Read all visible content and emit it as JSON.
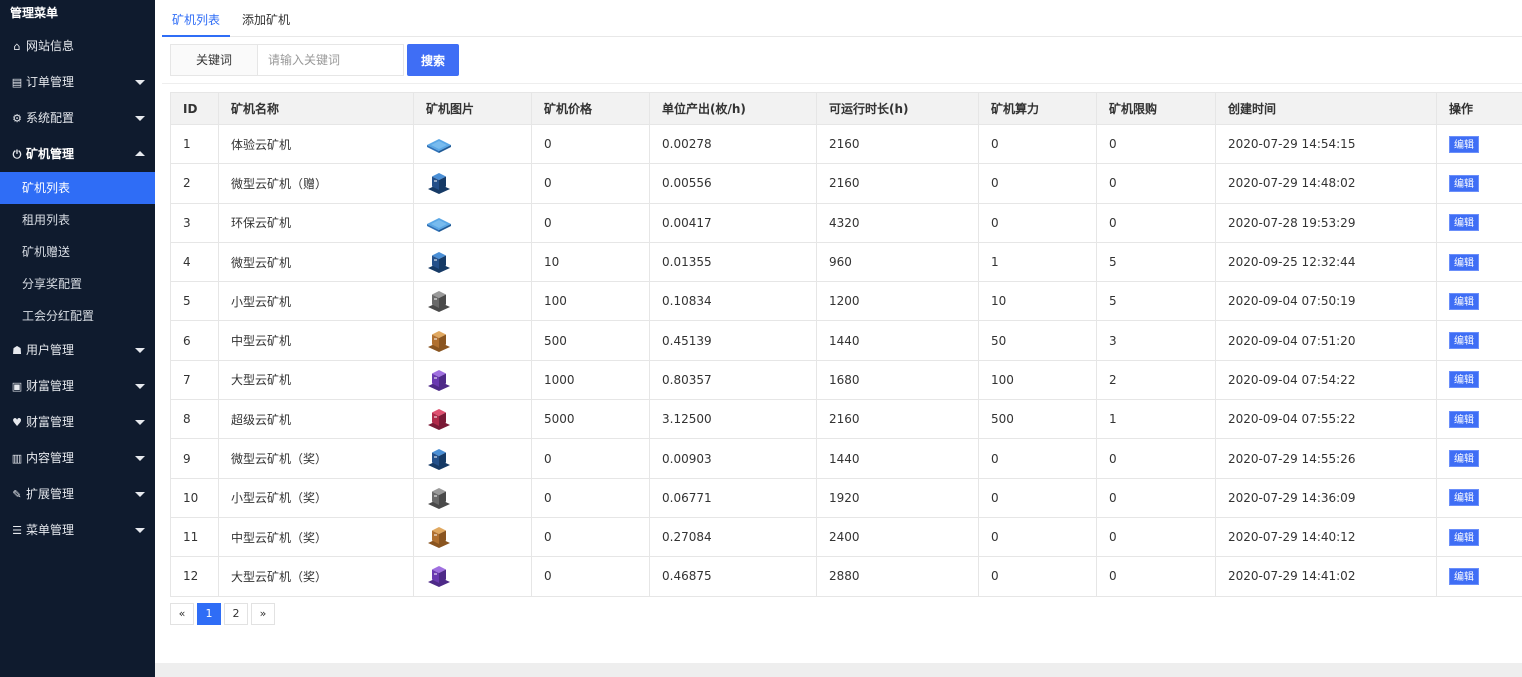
{
  "sidebar": {
    "header": "管理菜单",
    "items": [
      {
        "icon": "home-icon",
        "glyph": "⌂",
        "label": "网站信息"
      },
      {
        "icon": "list-icon",
        "glyph": "▤",
        "label": "订单管理"
      },
      {
        "icon": "gears-icon",
        "glyph": "⚙",
        "label": "系统配置"
      },
      {
        "icon": "power-icon",
        "glyph": "⏻",
        "label": "矿机管理"
      },
      {
        "icon": "users-icon",
        "glyph": "☗",
        "label": "用户管理"
      },
      {
        "icon": "money-icon",
        "glyph": "▣",
        "label": "财富管理"
      },
      {
        "icon": "heart-icon",
        "glyph": "♥",
        "label": "财富管理"
      },
      {
        "icon": "file-icon",
        "glyph": "▥",
        "label": "内容管理"
      },
      {
        "icon": "wrench-icon",
        "glyph": "✎",
        "label": "扩展管理"
      },
      {
        "icon": "bars-icon",
        "glyph": "☰",
        "label": "菜单管理"
      }
    ],
    "sub_items": [
      "矿机列表",
      "租用列表",
      "矿机赠送",
      "分享奖配置",
      "工会分红配置"
    ]
  },
  "tabs": [
    "矿机列表",
    "添加矿机"
  ],
  "search": {
    "label": "关键词",
    "placeholder": "请输入关键词",
    "button": "搜索"
  },
  "table": {
    "headers": [
      "ID",
      "矿机名称",
      "矿机图片",
      "矿机价格",
      "单位产出(枚/h)",
      "可运行时长(h)",
      "矿机算力",
      "矿机限购",
      "创建时间",
      "操作"
    ],
    "edit_label": "编辑",
    "rows": [
      {
        "id": "1",
        "name": "体验云矿机",
        "pic": "blue-flat",
        "price": "0",
        "output": "0.00278",
        "hours": "2160",
        "power": "0",
        "limit": "0",
        "created": "2020-07-29 14:54:15"
      },
      {
        "id": "2",
        "name": "微型云矿机（赠）",
        "pic": "blue-tower",
        "price": "0",
        "output": "0.00556",
        "hours": "2160",
        "power": "0",
        "limit": "0",
        "created": "2020-07-29 14:48:02"
      },
      {
        "id": "3",
        "name": "环保云矿机",
        "pic": "blue-flat",
        "price": "0",
        "output": "0.00417",
        "hours": "4320",
        "power": "0",
        "limit": "0",
        "created": "2020-07-28 19:53:29"
      },
      {
        "id": "4",
        "name": "微型云矿机",
        "pic": "blue-tower",
        "price": "10",
        "output": "0.01355",
        "hours": "960",
        "power": "1",
        "limit": "5",
        "created": "2020-09-25 12:32:44"
      },
      {
        "id": "5",
        "name": "小型云矿机",
        "pic": "gray",
        "price": "100",
        "output": "0.10834",
        "hours": "1200",
        "power": "10",
        "limit": "5",
        "created": "2020-09-04 07:50:19"
      },
      {
        "id": "6",
        "name": "中型云矿机",
        "pic": "orange",
        "price": "500",
        "output": "0.45139",
        "hours": "1440",
        "power": "50",
        "limit": "3",
        "created": "2020-09-04 07:51:20"
      },
      {
        "id": "7",
        "name": "大型云矿机",
        "pic": "purple",
        "price": "1000",
        "output": "0.80357",
        "hours": "1680",
        "power": "100",
        "limit": "2",
        "created": "2020-09-04 07:54:22"
      },
      {
        "id": "8",
        "name": "超级云矿机",
        "pic": "red",
        "price": "5000",
        "output": "3.12500",
        "hours": "2160",
        "power": "500",
        "limit": "1",
        "created": "2020-09-04 07:55:22"
      },
      {
        "id": "9",
        "name": "微型云矿机（奖）",
        "pic": "blue-tower",
        "price": "0",
        "output": "0.00903",
        "hours": "1440",
        "power": "0",
        "limit": "0",
        "created": "2020-07-29 14:55:26"
      },
      {
        "id": "10",
        "name": "小型云矿机（奖）",
        "pic": "gray",
        "price": "0",
        "output": "0.06771",
        "hours": "1920",
        "power": "0",
        "limit": "0",
        "created": "2020-07-29 14:36:09"
      },
      {
        "id": "11",
        "name": "中型云矿机（奖）",
        "pic": "orange",
        "price": "0",
        "output": "0.27084",
        "hours": "2400",
        "power": "0",
        "limit": "0",
        "created": "2020-07-29 14:40:12"
      },
      {
        "id": "12",
        "name": "大型云矿机（奖）",
        "pic": "purple",
        "price": "0",
        "output": "0.46875",
        "hours": "2880",
        "power": "0",
        "limit": "0",
        "created": "2020-07-29 14:41:02"
      }
    ]
  },
  "pagination": {
    "prev": "«",
    "pages": [
      "1",
      "2"
    ],
    "current": "1",
    "next": "»"
  },
  "colors": {
    "sidebar_bg": "#0f1b2e",
    "accent": "#2f6df6",
    "button": "#3f6ef5"
  }
}
